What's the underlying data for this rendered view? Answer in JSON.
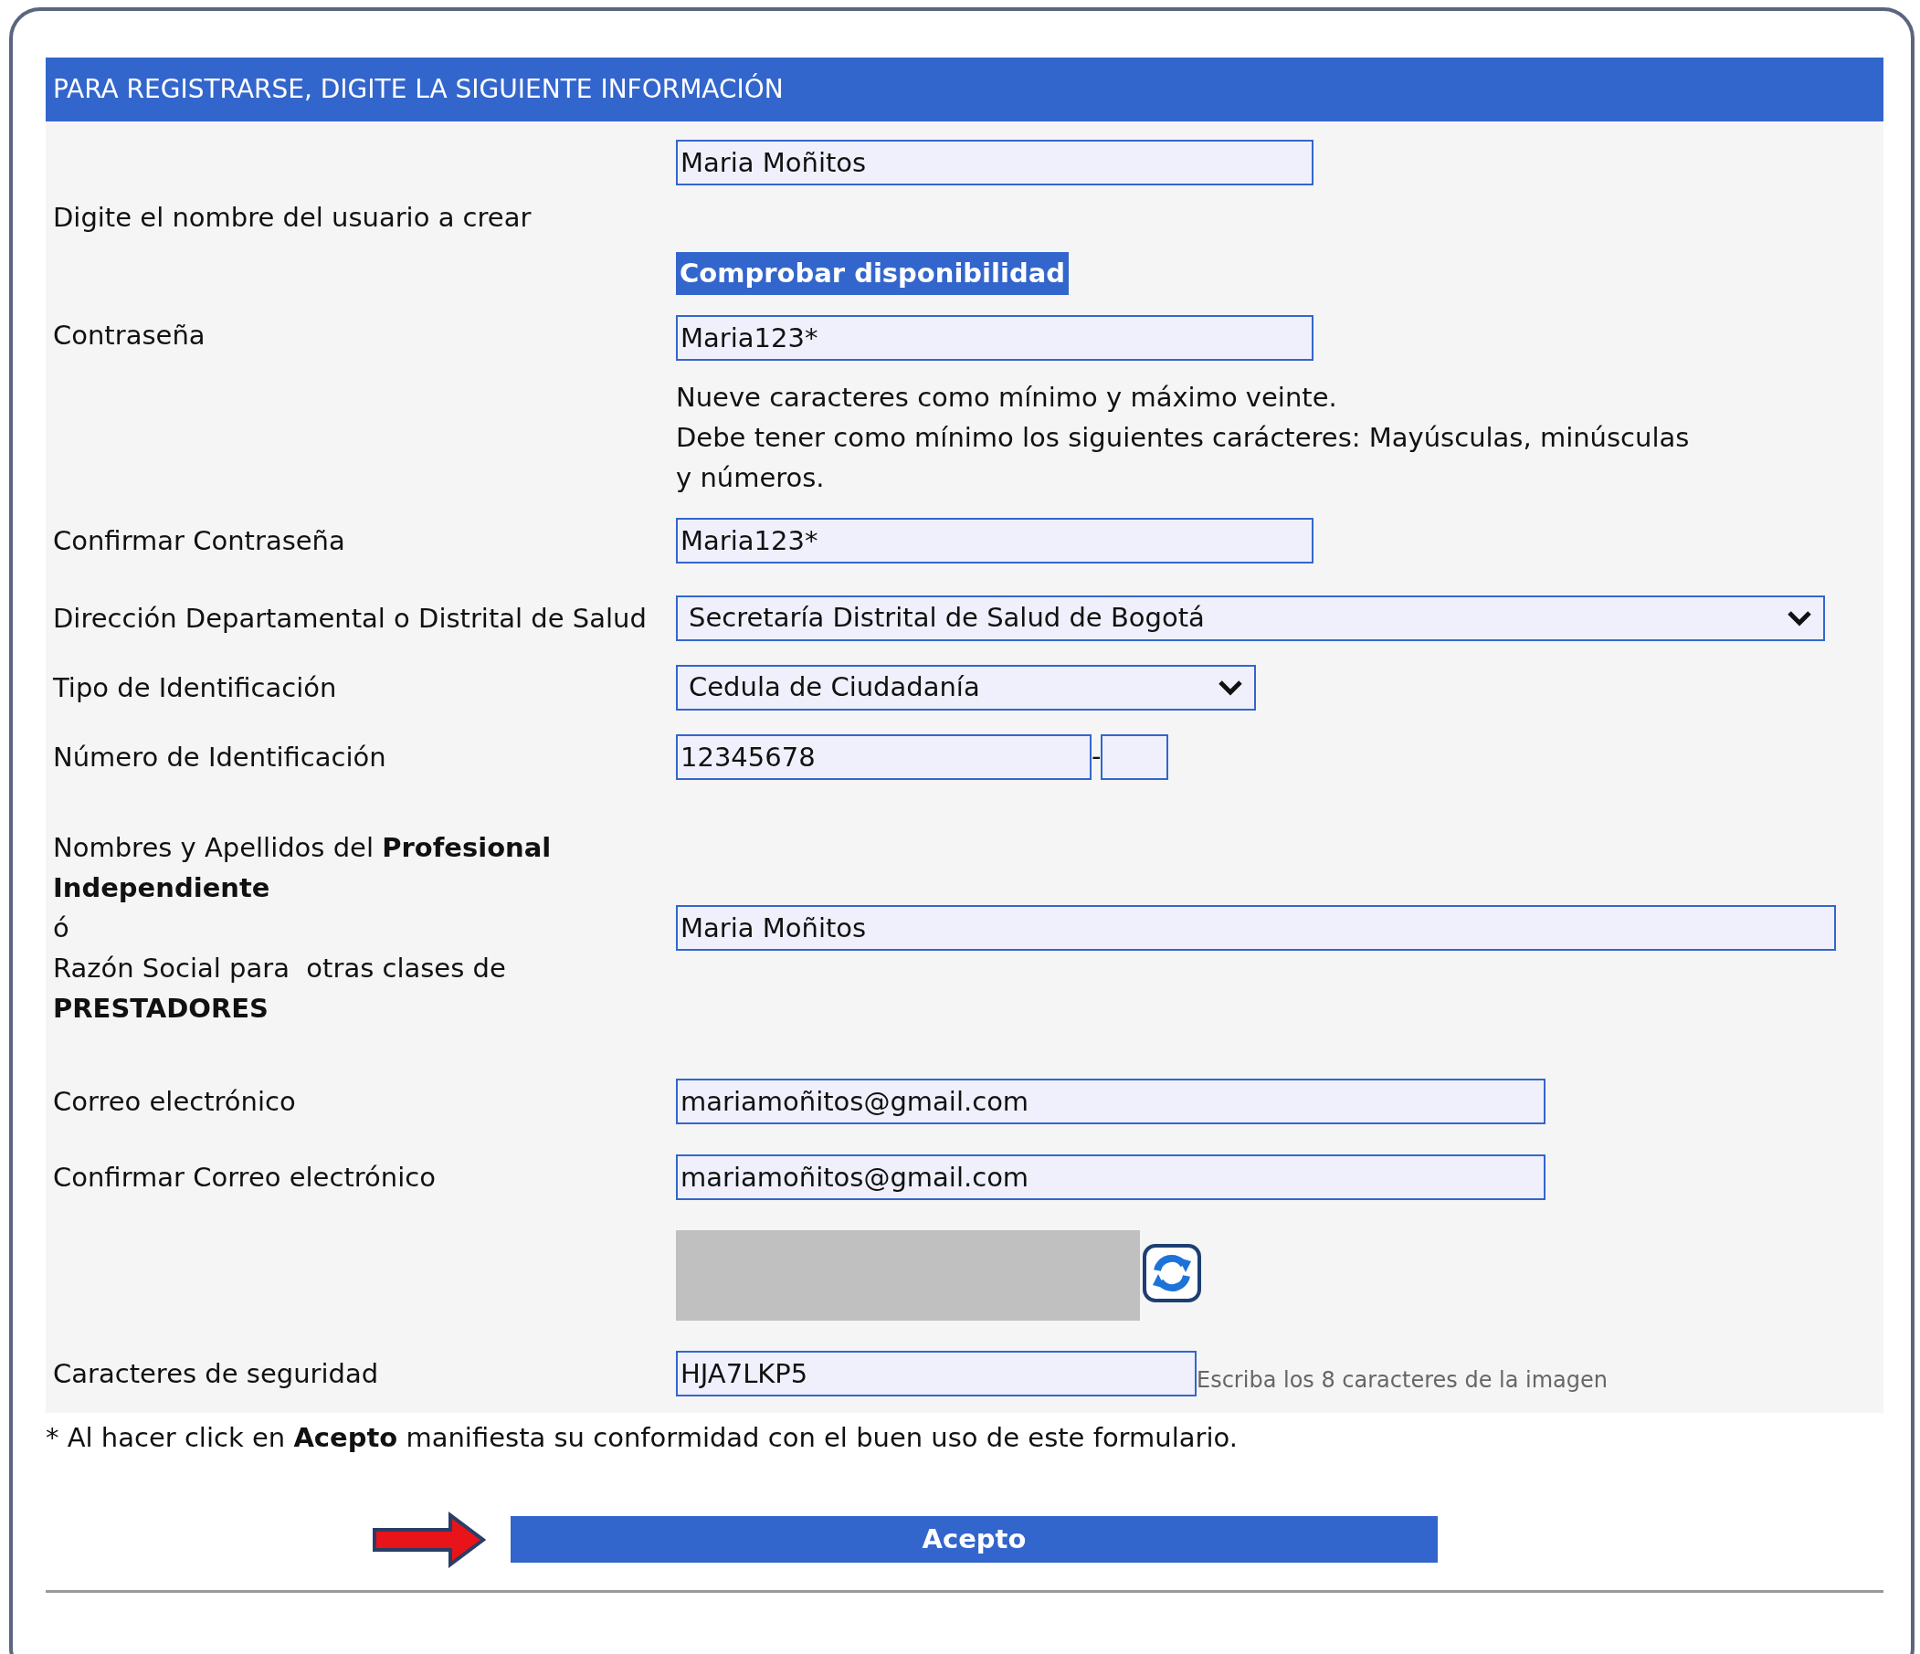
{
  "header": "PARA REGISTRARSE, DIGITE LA SIGUIENTE INFORMACIÓN",
  "rows": [
    {
      "kind": "text",
      "label": "Digite el nombre del usuario a crear",
      "value": "Maria Moñitos",
      "button": "Comprobar disponibilidad"
    },
    {
      "kind": "text",
      "label": "Contraseña",
      "value": "Maria123*",
      "help": [
        "Nueve caracteres como mínimo y máximo veinte.",
        "Debe tener como mínimo los siguientes carácteres: Mayúsculas, minúsculas y números."
      ]
    },
    {
      "kind": "text",
      "label": "Confirmar Contraseña",
      "value": "Maria123*"
    },
    {
      "kind": "select",
      "label": "Dirección Departamental o Distrital de Salud",
      "value": "Secretaría Distrital de Salud de Bogotá"
    },
    {
      "kind": "select",
      "label": "Tipo de Identificación",
      "value": "Cedula de Ciudadanía"
    },
    {
      "kind": "id",
      "label": "Número de Identificación",
      "value": "12345678",
      "separator": "-"
    },
    {
      "kind": "text",
      "label_lines": [
        "Nombres y Apellidos del **Profesional Independiente**",
        "ó",
        "Razón Social para  otras clases de **PRESTADORES**"
      ],
      "value": "Maria Moñitos"
    },
    {
      "kind": "text",
      "label": "Correo electrónico",
      "value": "mariamoñitos@gmail.com"
    },
    {
      "kind": "text",
      "label": "Confirmar Correo electrónico",
      "value": "mariamoñitos@gmail.com"
    },
    {
      "kind": "captcha"
    },
    {
      "kind": "text",
      "label": "Caracteres de seguridad",
      "value": "HJA7LKP5",
      "hint": "Escriba los 8 caracteres de la imagen"
    }
  ],
  "note": "* Al hacer click en **Acepto** manifiesta su conformidad con el buen uso de este formulario.",
  "submit": "Acepto"
}
